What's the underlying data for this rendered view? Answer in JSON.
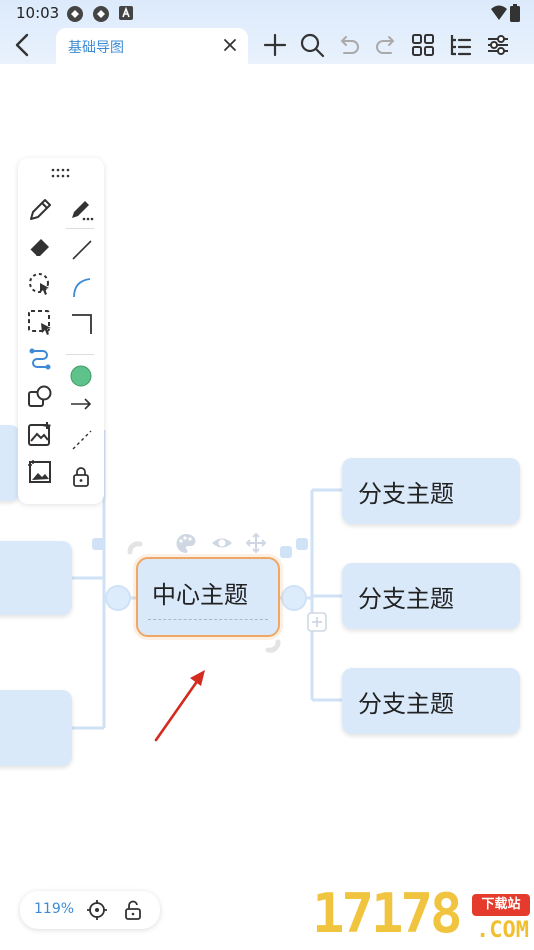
{
  "status_bar": {
    "time": "10:03"
  },
  "header": {
    "tab_title": "基础导图",
    "tools": [
      "back-icon",
      "close-icon",
      "add-icon",
      "search-icon",
      "undo-icon",
      "redo-icon",
      "grid-icon",
      "outline-icon",
      "settings-sliders-icon"
    ]
  },
  "toolbar": {
    "left_column": [
      "pencil-icon",
      "eraser-icon",
      "lasso-select-icon",
      "box-select-icon",
      "connector-icon",
      "shape-icon",
      "insert-image-icon",
      "image-icon"
    ],
    "right_column": [
      "pen-style-icon",
      "line-icon",
      "curve-icon",
      "elbow-line-icon",
      "color-swatch-icon",
      "arrow-icon",
      "dashed-line-icon",
      "lock-icon"
    ],
    "active_color": "#5ec38a",
    "accent": "#3d8bd6"
  },
  "mindmap": {
    "center_topic": "中心主题",
    "branches": [
      {
        "label": "分支主题"
      },
      {
        "label": "分支主题"
      },
      {
        "label": "分支主题"
      }
    ],
    "node_color": "#d9e9fa",
    "center_border_color": "#f0a766"
  },
  "bottom": {
    "zoom": "119%"
  },
  "watermark": {
    "number": "17178",
    "badge": "下载站",
    "domain": ".COM"
  }
}
